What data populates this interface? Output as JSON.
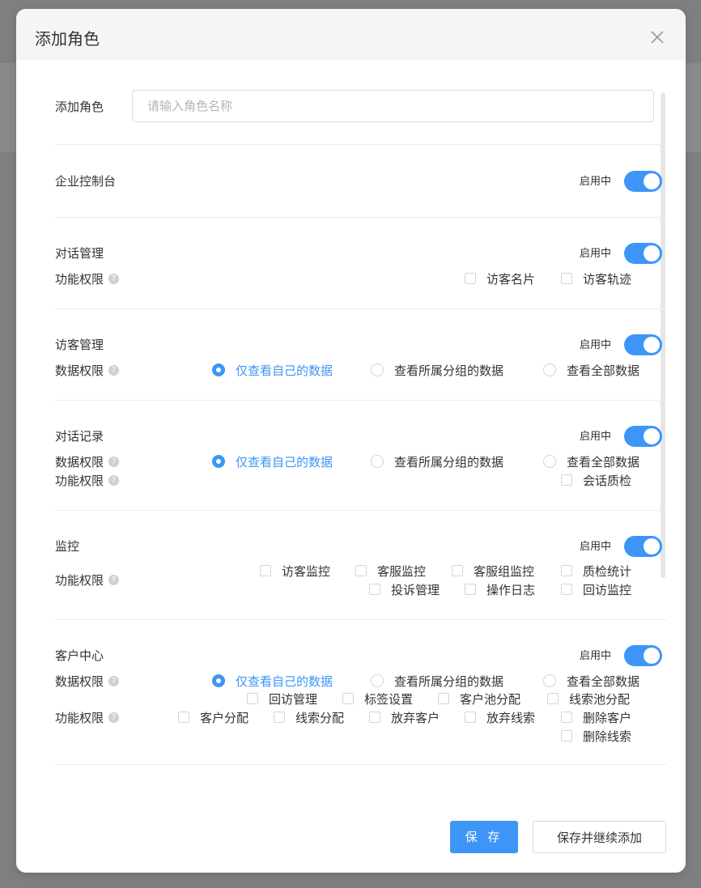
{
  "dialog": {
    "title": "添加角色",
    "name_label": "添加角色",
    "name_placeholder": "请输入角色名称",
    "status_text": "启用中",
    "help_glyph": "?",
    "save_label": "保 存",
    "save_continue_label": "保存并继续添加"
  },
  "sections": {
    "console": {
      "title": "企业控制台"
    },
    "conversation": {
      "title": "对话管理",
      "func_label": "功能权限",
      "func_options": [
        "访客名片",
        "访客轨迹"
      ]
    },
    "visitor": {
      "title": "访客管理",
      "data_label": "数据权限",
      "data_options": [
        "仅查看自己的数据",
        "查看所属分组的数据",
        "查看全部数据"
      ]
    },
    "records": {
      "title": "对话记录",
      "data_label": "数据权限",
      "data_options": [
        "仅查看自己的数据",
        "查看所属分组的数据",
        "查看全部数据"
      ],
      "func_label": "功能权限",
      "func_options": [
        "会话质检"
      ]
    },
    "monitor": {
      "title": "监控",
      "func_label": "功能权限",
      "func_options": [
        "访客监控",
        "客服监控",
        "客服组监控",
        "质检统计",
        "投诉管理",
        "操作日志",
        "回访监控"
      ]
    },
    "customer": {
      "title": "客户中心",
      "data_label": "数据权限",
      "data_options": [
        "仅查看自己的数据",
        "查看所属分组的数据",
        "查看全部数据"
      ],
      "func_label": "功能权限",
      "func_options": [
        "回访管理",
        "标签设置",
        "客户池分配",
        "线索池分配",
        "客户分配",
        "线索分配",
        "放弃客户",
        "放弃线索",
        "删除客户",
        "删除线索"
      ]
    }
  },
  "colors": {
    "accent": "#3d95f7",
    "overlay": "#7f7f7f"
  }
}
